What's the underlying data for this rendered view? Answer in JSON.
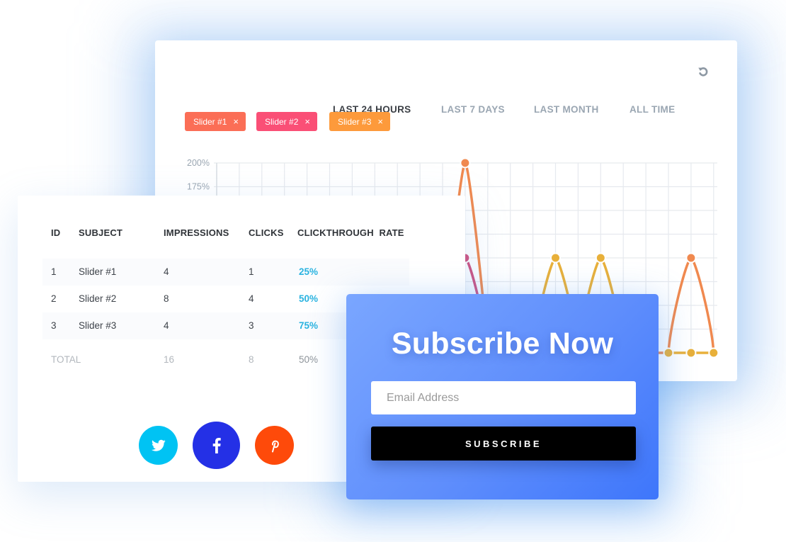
{
  "chart_panel": {
    "tabs": [
      {
        "label": "LAST 24 HOURS",
        "active": true
      },
      {
        "label": "LAST 7 DAYS",
        "active": false
      },
      {
        "label": "LAST MONTH",
        "active": false
      },
      {
        "label": "ALL TIME",
        "active": false
      }
    ],
    "refresh_icon": "refresh-icon",
    "filter_chips": [
      {
        "label": "Slider #1",
        "remove": "×",
        "color": "#fb6e56"
      },
      {
        "label": "Slider #2",
        "remove": "×",
        "color": "#fa4f76"
      },
      {
        "label": "Slider #3",
        "remove": "×",
        "color": "#fd9a3b"
      }
    ]
  },
  "chart_data": {
    "type": "line",
    "title": "",
    "xlabel": "",
    "ylabel": "",
    "ylim": [
      0,
      200
    ],
    "yticks_visible": [
      "200%",
      "175%"
    ],
    "yticks": [
      0,
      25,
      50,
      75,
      100,
      125,
      150,
      175,
      200
    ],
    "grid": true,
    "x": [
      0,
      1,
      2,
      3,
      4,
      5,
      6,
      7,
      8,
      9,
      10,
      11,
      12,
      13,
      14,
      15,
      16,
      17,
      18,
      19,
      20,
      21,
      22
    ],
    "series": [
      {
        "name": "Slider #1",
        "color": "#f0894f",
        "values": [
          null,
          null,
          null,
          null,
          null,
          null,
          null,
          null,
          null,
          null,
          0,
          200,
          0,
          null,
          null,
          null,
          null,
          null,
          null,
          0,
          0,
          100,
          0
        ]
      },
      {
        "name": "Slider #2",
        "color": "#d0507e",
        "values": [
          null,
          null,
          null,
          null,
          null,
          null,
          null,
          null,
          null,
          null,
          0,
          100,
          0,
          null,
          null,
          null,
          null,
          null,
          null,
          null,
          null,
          null,
          null
        ]
      },
      {
        "name": "Slider #3",
        "color": "#e8b03a",
        "values": [
          null,
          null,
          null,
          null,
          null,
          null,
          null,
          null,
          null,
          null,
          null,
          null,
          null,
          null,
          0,
          100,
          0,
          100,
          0,
          null,
          0,
          0,
          0
        ]
      }
    ]
  },
  "table": {
    "headers": [
      "ID",
      "SUBJECT",
      "IMPRESSIONS",
      "CLICKS",
      "CLICKTHROUGH  RATE"
    ],
    "rows": [
      {
        "id": "1",
        "subject": "Slider #1",
        "impressions": "4",
        "clicks": "1",
        "rate": "25%"
      },
      {
        "id": "2",
        "subject": "Slider #2",
        "impressions": "8",
        "clicks": "4",
        "rate": "50%"
      },
      {
        "id": "3",
        "subject": "Slider #3",
        "impressions": "4",
        "clicks": "3",
        "rate": "75%"
      }
    ],
    "total": {
      "label": "TOTAL",
      "impressions": "16",
      "clicks": "8",
      "rate": "50%"
    }
  },
  "social": [
    {
      "name": "twitter",
      "icon": "twitter-icon",
      "color": "#00c3f3"
    },
    {
      "name": "facebook",
      "icon": "facebook-icon",
      "color": "#2430e6"
    },
    {
      "name": "pinterest",
      "icon": "pinterest-icon",
      "color": "#fe4a0a"
    }
  ],
  "subscribe": {
    "title": "Subscribe Now",
    "email_placeholder": "Email Address",
    "email_value": "",
    "button_label": "SUBSCRIBE"
  }
}
